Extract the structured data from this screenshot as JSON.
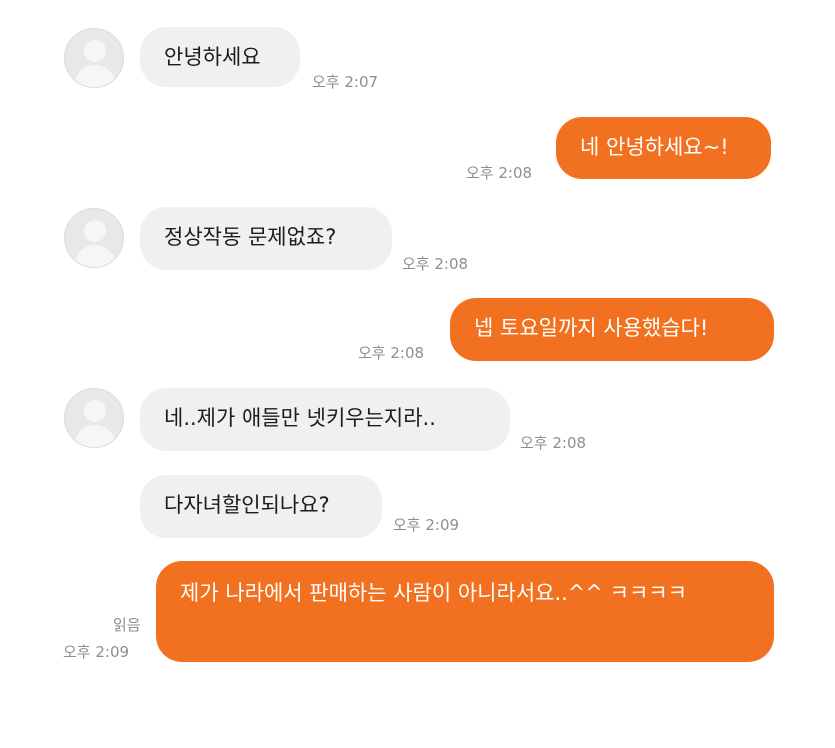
{
  "messages": [
    {
      "text": "안녕하세요",
      "time": "오후 2:07"
    },
    {
      "text": "네 안녕하세요~!",
      "time": "오후 2:08"
    },
    {
      "text": "정상작동 문제없죠?",
      "time": "오후 2:08"
    },
    {
      "text": "넵 토요일까지 사용했습다!",
      "time": "오후 2:08"
    },
    {
      "text": "네..제가 애들만 넷키우는지라..",
      "time": "오후 2:08"
    },
    {
      "text": "다자녀할인되나요?",
      "time": "오후 2:09"
    },
    {
      "text": "제가 나라에서 판매하는 사람이 아니라서요..^^ ㅋㅋㅋㅋ",
      "time": "오후 2:09",
      "read": "읽음"
    }
  ],
  "colors": {
    "outgoing": "#f27121",
    "incoming": "#f0f0f2",
    "timestamp": "#8e8e93"
  },
  "icons": {
    "avatar": "person-silhouette-icon"
  }
}
